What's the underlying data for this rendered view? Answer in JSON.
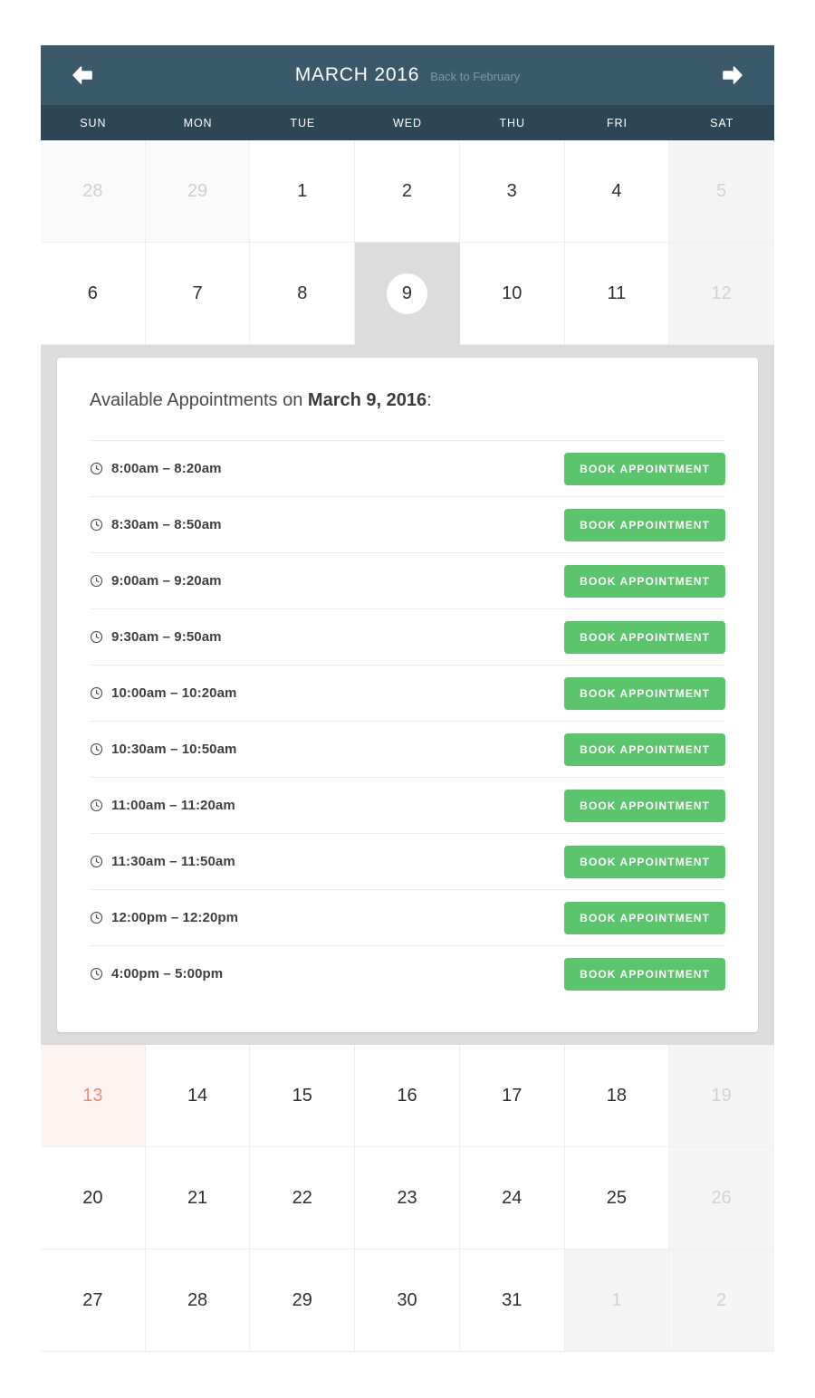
{
  "header": {
    "month_title": "MARCH 2016",
    "back_link": "Back to February",
    "prev_icon": "arrow-left-icon",
    "next_icon": "arrow-right-icon",
    "bg_color": "#3a5a6c",
    "weekday_bar_color": "#2c4656"
  },
  "weekdays": [
    "SUN",
    "MON",
    "TUE",
    "WED",
    "THU",
    "FRI",
    "SAT"
  ],
  "weeks": [
    [
      {
        "num": "28",
        "state": "muted"
      },
      {
        "num": "29",
        "state": "muted"
      },
      {
        "num": "1",
        "state": "normal"
      },
      {
        "num": "2",
        "state": "normal"
      },
      {
        "num": "3",
        "state": "normal"
      },
      {
        "num": "4",
        "state": "normal"
      },
      {
        "num": "5",
        "state": "disabled"
      }
    ],
    [
      {
        "num": "6",
        "state": "normal"
      },
      {
        "num": "7",
        "state": "normal"
      },
      {
        "num": "8",
        "state": "normal"
      },
      {
        "num": "9",
        "state": "selected"
      },
      {
        "num": "10",
        "state": "normal"
      },
      {
        "num": "11",
        "state": "normal"
      },
      {
        "num": "12",
        "state": "disabled"
      }
    ]
  ],
  "weeks_after": [
    [
      {
        "num": "13",
        "state": "today"
      },
      {
        "num": "14",
        "state": "normal"
      },
      {
        "num": "15",
        "state": "normal"
      },
      {
        "num": "16",
        "state": "normal"
      },
      {
        "num": "17",
        "state": "normal"
      },
      {
        "num": "18",
        "state": "normal"
      },
      {
        "num": "19",
        "state": "disabled"
      }
    ],
    [
      {
        "num": "20",
        "state": "normal"
      },
      {
        "num": "21",
        "state": "normal"
      },
      {
        "num": "22",
        "state": "normal"
      },
      {
        "num": "23",
        "state": "normal"
      },
      {
        "num": "24",
        "state": "normal"
      },
      {
        "num": "25",
        "state": "normal"
      },
      {
        "num": "26",
        "state": "disabled"
      }
    ],
    [
      {
        "num": "27",
        "state": "normal"
      },
      {
        "num": "28",
        "state": "normal"
      },
      {
        "num": "29",
        "state": "normal"
      },
      {
        "num": "30",
        "state": "normal"
      },
      {
        "num": "31",
        "state": "normal"
      },
      {
        "num": "1",
        "state": "disabled"
      },
      {
        "num": "2",
        "state": "disabled"
      }
    ]
  ],
  "appointments": {
    "heading_prefix": "Available Appointments on ",
    "heading_date": "March 9, 2016",
    "heading_suffix": ":",
    "book_label": "BOOK APPOINTMENT",
    "button_color": "#5cc46c",
    "clock_icon": "clock-icon",
    "slots": [
      {
        "time": "8:00am – 8:20am"
      },
      {
        "time": "8:30am – 8:50am"
      },
      {
        "time": "9:00am – 9:20am"
      },
      {
        "time": "9:30am – 9:50am"
      },
      {
        "time": "10:00am – 10:20am"
      },
      {
        "time": "10:30am – 10:50am"
      },
      {
        "time": "11:00am – 11:20am"
      },
      {
        "time": "11:30am – 11:50am"
      },
      {
        "time": "12:00pm – 12:20pm"
      },
      {
        "time": "4:00pm – 5:00pm"
      }
    ]
  },
  "accent_colors": {
    "today_text": "#ec8d72",
    "today_bg": "#fdf3f0",
    "selected_bg": "#dcdcdc"
  }
}
